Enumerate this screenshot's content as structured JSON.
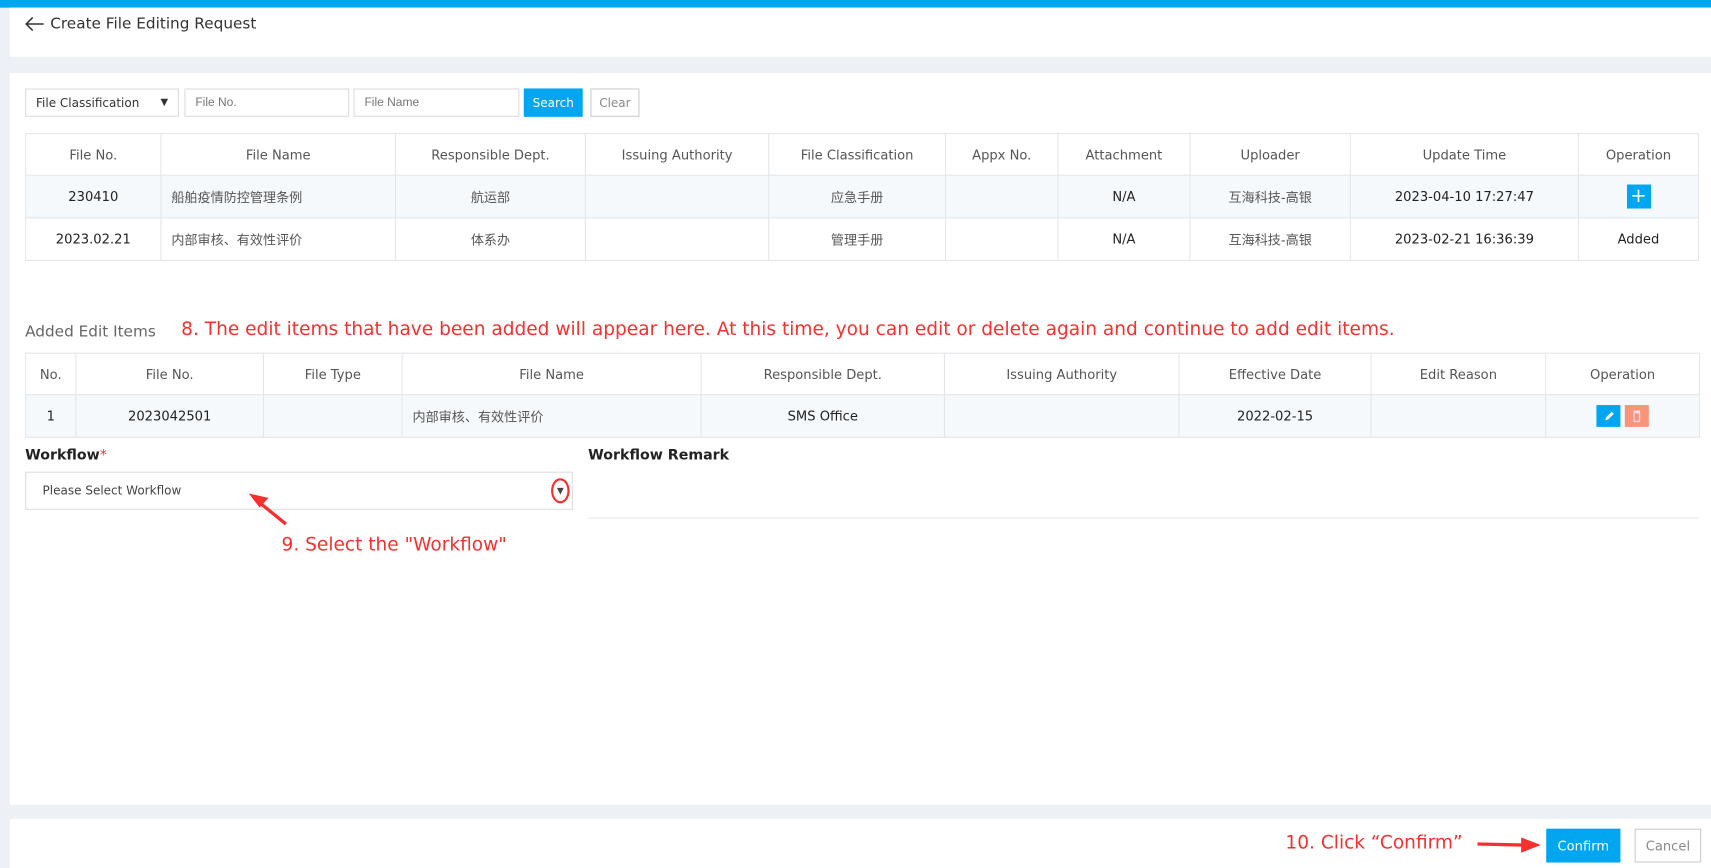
{
  "header": {
    "title": "Create File Editing Request",
    "back_icon": "arrow-left-icon"
  },
  "filters": {
    "classification_placeholder": "File Classification",
    "file_no_placeholder": "File No.",
    "file_name_placeholder": "File Name",
    "search_label": "Search",
    "clear_label": "Clear"
  },
  "files_table": {
    "columns": [
      "File No.",
      "File Name",
      "Responsible Dept.",
      "Issuing Authority",
      "File Classification",
      "Appx No.",
      "Attachment",
      "Uploader",
      "Update Time",
      "Operation"
    ],
    "rows": [
      {
        "file_no": "230410",
        "file_name": "船舶疫情防控管理条例",
        "dept": "航运部",
        "authority": "",
        "classification": "应急手册",
        "appx_no": "",
        "attachment": "N/A",
        "uploader": "互海科技-高银",
        "update_time": "2023-04-10 17:27:47",
        "operation": "+"
      },
      {
        "file_no": "2023.02.21",
        "file_name": "内部审核、有效性评价",
        "dept": "体系办",
        "authority": "",
        "classification": "管理手册",
        "appx_no": "",
        "attachment": "N/A",
        "uploader": "互海科技-高银",
        "update_time": "2023-02-21 16:36:39",
        "operation": "Added"
      }
    ]
  },
  "added_items": {
    "title": "Added Edit Items",
    "annotation": "8. The edit items that have been added will appear here. At this time, you can edit or delete again and continue to add edit items.",
    "columns": [
      "No.",
      "File No.",
      "File Type",
      "File Name",
      "Responsible Dept.",
      "Issuing Authority",
      "Effective Date",
      "Edit Reason",
      "Operation"
    ],
    "rows": [
      {
        "no": "1",
        "file_no": "2023042501",
        "file_type": "",
        "file_name": "内部审核、有效性评价",
        "dept": "SMS Office",
        "authority": "",
        "effective_date": "2022-02-15",
        "edit_reason": ""
      }
    ]
  },
  "workflow": {
    "label": "Workflow",
    "required_mark": "*",
    "placeholder": "Please Select Workflow",
    "annotation": "9. Select the \"Workflow\"",
    "remark_label": "Workflow Remark"
  },
  "footer": {
    "annotation": "10. Click  “Confirm”",
    "confirm_label": "Confirm",
    "cancel_label": "Cancel"
  },
  "colors": {
    "accent": "#00a6f0",
    "delete": "#f79479",
    "annotation": "#f5302f"
  }
}
